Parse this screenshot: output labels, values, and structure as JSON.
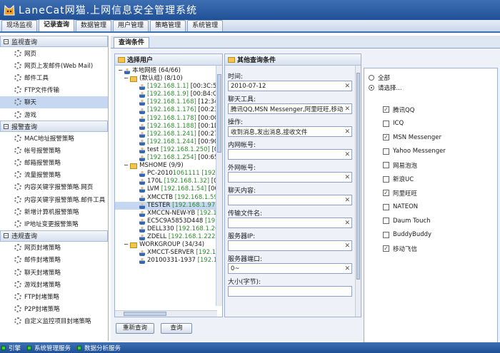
{
  "app": {
    "title": "LaneCat网猫.上网信息安全管理系统"
  },
  "tabs": [
    "现场监视",
    "记录查询",
    "数据管理",
    "用户管理",
    "策略管理",
    "系统管理"
  ],
  "nav": {
    "groups": [
      {
        "title": "监视查询",
        "items": [
          "网页",
          "网页上发邮件(Web Mail)",
          "邮件工具",
          "FTP文件传输",
          "聊天",
          "游戏"
        ]
      },
      {
        "title": "报警查询",
        "items": [
          "MAC地址报警策略",
          "帐号报警策略",
          "邮箱报警策略",
          "流量报警策略",
          "内容关键字报警策略.网页",
          "内容关键字报警策略.邮件工具",
          "新增计算机报警策略",
          "IP地址变更报警策略"
        ]
      },
      {
        "title": "违规查询",
        "items": [
          "网页封堵策略",
          "邮件封堵策略",
          "聊天封堵策略",
          "游戏封堵策略",
          "FTP封堵策略",
          "P2P封堵策略",
          "自定义监控项目封堵策略"
        ]
      }
    ]
  },
  "subtab": "查询条件",
  "users": {
    "title": "选择用户",
    "root": "本地网络 (64/66)",
    "groups": [
      {
        "name": "(默认组) (8/10)",
        "rows": [
          {
            "ip": "[192.168.1.1]",
            "mac": "[00:3C:50"
          },
          {
            "ip": "[192.168.1.9]",
            "mac": "[00:B4:C"
          },
          {
            "ip": "[192.168.1.168]",
            "mac": "[12:34:5"
          },
          {
            "ip": "[192.168.1.176]",
            "mac": "[00:23:7"
          },
          {
            "ip": "[192.168.1.178]",
            "mac": "[00:0C:2"
          },
          {
            "ip": "[192.168.1.188]",
            "mac": "[00:1D:F"
          },
          {
            "ip": "[192.168.1.241]",
            "mac": "[00:27:1"
          },
          {
            "ip": "[192.168.1.244]",
            "mac": "[00:90:0"
          },
          {
            "name": "test",
            "ip": "[192.168.1.250]",
            "mac": "[00:"
          },
          {
            "ip": "[192.168.1.254]",
            "mac": "[00:65:5"
          }
        ]
      },
      {
        "name": "MSHOME (9/9)",
        "rows": [
          {
            "name": "PC-2010",
            "ip": "1061111 [192"
          },
          {
            "name": "170L",
            "ip": "[192.168.1.32]",
            "mac": "[00:"
          },
          {
            "name": "LVM",
            "ip": "[192.168.1.54]",
            "mac": "[00:0"
          },
          {
            "name": "XMCCTB",
            "ip": "[192.168.1.59]"
          },
          {
            "name": "TESTER",
            "ip": "[192.168.1.97]"
          },
          {
            "name": "XMCCN-NEW-YB",
            "ip": "[192.1"
          },
          {
            "name": "EC5C9A5853D448",
            "ip": "[19"
          },
          {
            "name": "DELL330",
            "ip": "[192.168.1.20"
          },
          {
            "name": "ZDELL",
            "ip": "[192.168.1.222]",
            "mac": "["
          }
        ]
      },
      {
        "name": "WORKGROUP (34/34)",
        "rows": [
          {
            "name": "XMCCT-SERVER",
            "ip": "[192.1"
          },
          {
            "name": "20100331-1937",
            "ip": "[192.16"
          }
        ]
      }
    ]
  },
  "conditions": {
    "title": "其他查询条件",
    "fields": [
      {
        "label": "时间:",
        "value": "2010-07-12"
      },
      {
        "label": "聊天工具:",
        "value": "腾讯QQ,MSN Messenger,阿里旺旺,移动飞"
      },
      {
        "label": "操作:",
        "value": "收到消息,发出消息,接收文件"
      },
      {
        "label": "内网帐号:",
        "value": ""
      },
      {
        "label": "外网帐号:",
        "value": ""
      },
      {
        "label": "聊天内容:",
        "value": ""
      },
      {
        "label": "传输文件名:",
        "value": ""
      },
      {
        "label": "服务器IP:",
        "value": ""
      },
      {
        "label": "服务器端口:",
        "value": "0~"
      },
      {
        "label": "大小(字节):",
        "value": ""
      }
    ]
  },
  "apps": {
    "radios": [
      {
        "label": "全部",
        "checked": false
      },
      {
        "label": "请选择...",
        "checked": true
      }
    ],
    "options": [
      {
        "label": "腾讯QQ",
        "checked": true
      },
      {
        "label": "ICQ",
        "checked": false
      },
      {
        "label": "MSN Messenger",
        "checked": true
      },
      {
        "label": "Yahoo Messenger",
        "checked": false
      },
      {
        "label": "网易泡泡",
        "checked": false
      },
      {
        "label": "新浪UC",
        "checked": false
      },
      {
        "label": "阿里旺旺",
        "checked": true
      },
      {
        "label": "NATEON",
        "checked": false
      },
      {
        "label": "Daum Touch",
        "checked": false
      },
      {
        "label": "BuddyBuddy",
        "checked": false
      },
      {
        "label": "移动飞信",
        "checked": true
      }
    ]
  },
  "buttons": {
    "reset": "重新查询",
    "query": "查询"
  },
  "status": [
    "引擎",
    "系统管理服务",
    "数据分析服务"
  ]
}
